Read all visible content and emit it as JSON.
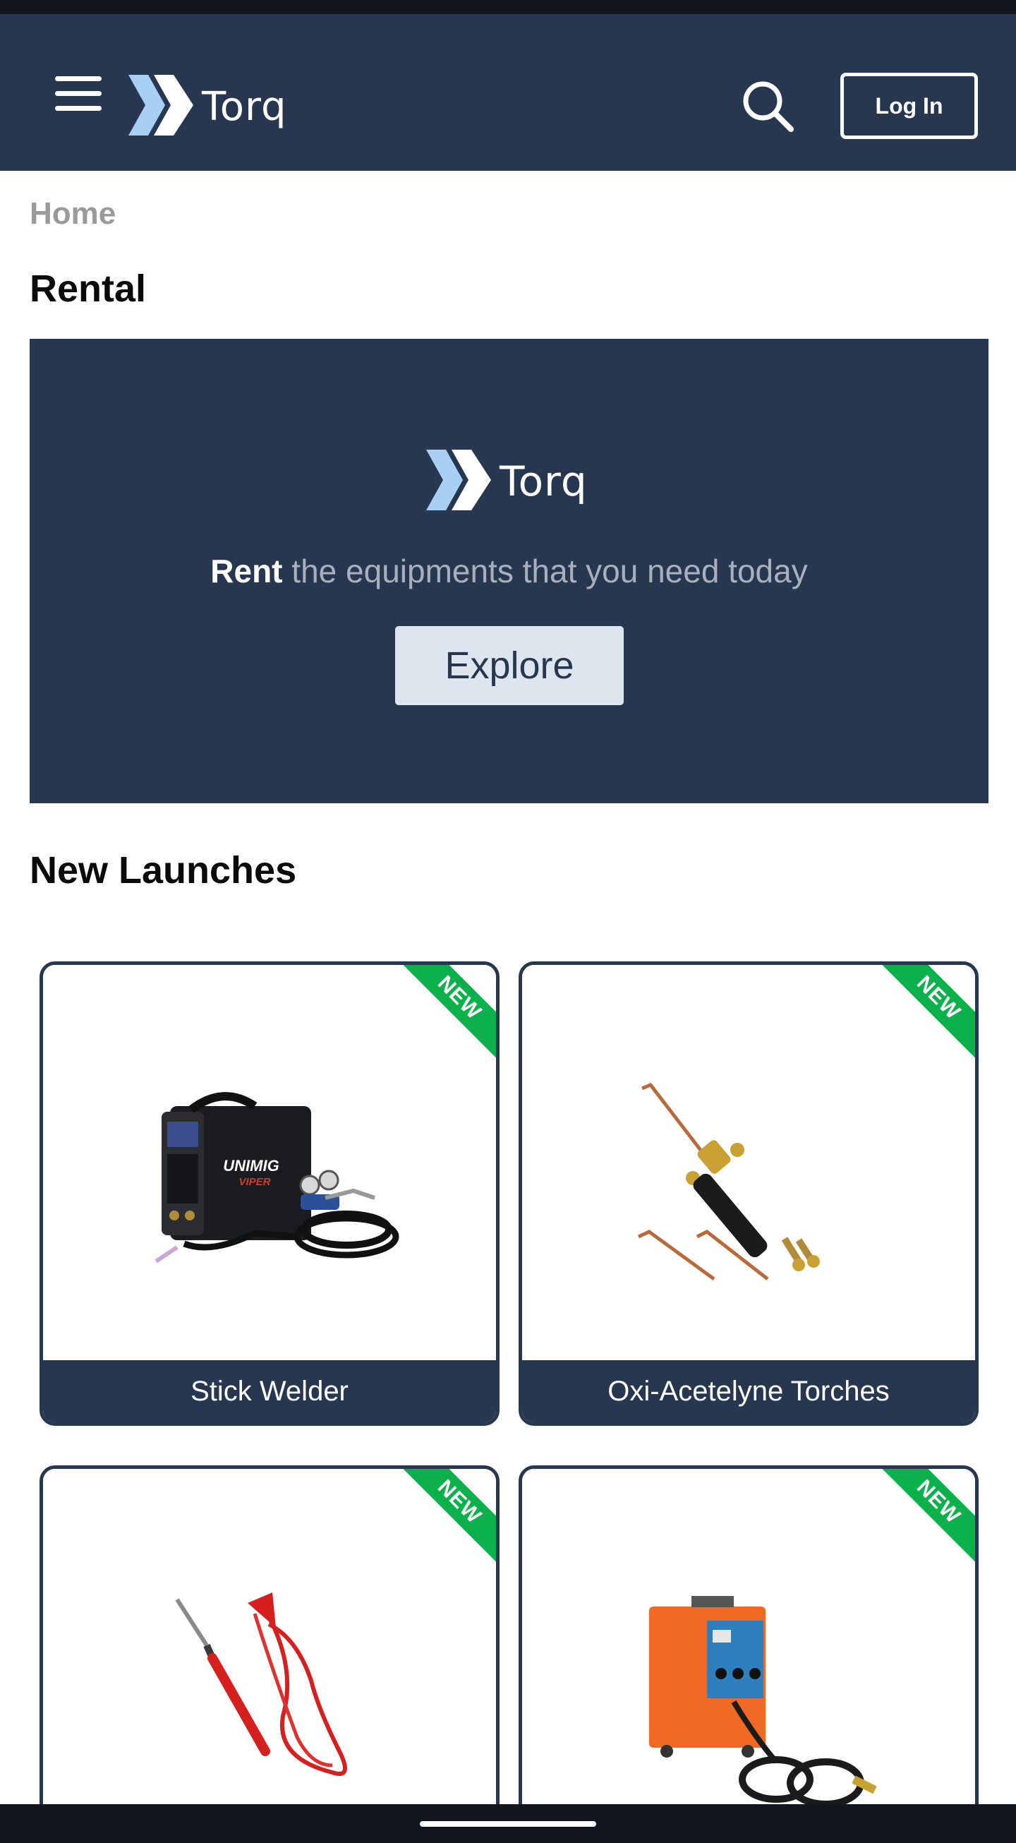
{
  "header": {
    "brand": "Torq",
    "login_label": "Log In",
    "colors": {
      "bar": "#283750",
      "accent": "#a8d0f5"
    }
  },
  "breadcrumb": {
    "home": "Home"
  },
  "page": {
    "title": "Rental"
  },
  "hero": {
    "brand": "Torq",
    "tagline_strong": "Rent",
    "tagline_rest": " the equipments that you need today",
    "explore_label": "Explore"
  },
  "new_launches": {
    "title": "New Launches",
    "badge": "NEW",
    "products": [
      {
        "name": "Stick Welder",
        "icon": "welder-machine-image"
      },
      {
        "name": "Oxi-Acetelyne Torches",
        "icon": "torch-image"
      },
      {
        "name": "",
        "icon": "soldering-iron-image"
      },
      {
        "name": "",
        "icon": "arc-welder-image"
      }
    ]
  }
}
